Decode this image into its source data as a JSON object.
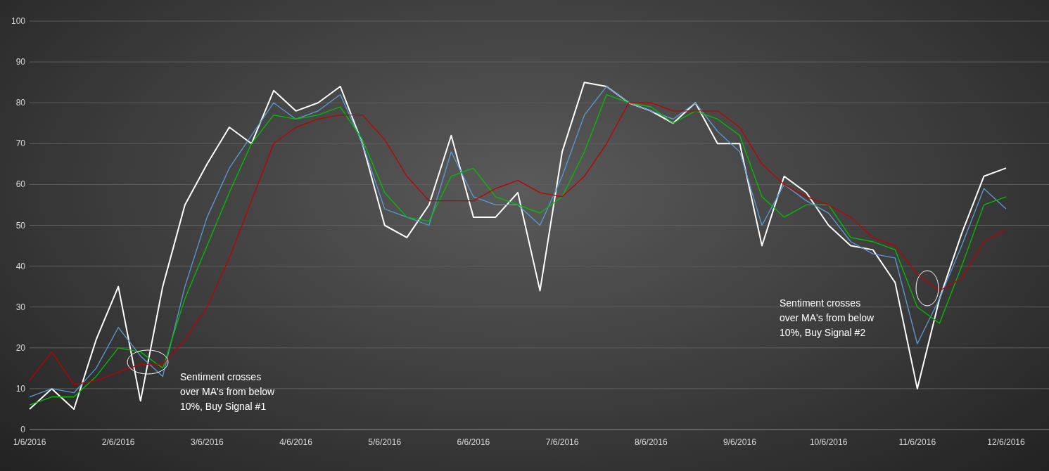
{
  "chart_data": {
    "type": "line",
    "categories": [
      "1/6/2016",
      null,
      null,
      null,
      "2/6/2016",
      null,
      null,
      null,
      "3/6/2016",
      null,
      null,
      null,
      "4/6/2016",
      null,
      null,
      null,
      "5/6/2016",
      null,
      null,
      null,
      "6/6/2016",
      null,
      null,
      null,
      "7/6/2016",
      null,
      null,
      null,
      "8/6/2016",
      null,
      null,
      null,
      "9/6/2016",
      null,
      null,
      null,
      "10/6/2016",
      null,
      null,
      null,
      "11/6/2016",
      null,
      null,
      null,
      "12/6/2016"
    ],
    "series": [
      {
        "color": "#ffffff",
        "values": [
          5,
          10,
          5,
          22,
          35,
          7,
          35,
          55,
          65,
          74,
          70,
          83,
          78,
          80,
          84,
          70,
          50,
          47,
          55,
          72,
          52,
          52,
          58,
          34,
          68,
          85,
          84,
          80,
          78,
          75,
          80,
          70,
          70,
          45,
          62,
          58,
          50,
          45,
          44,
          36,
          10,
          32,
          48,
          62,
          64
        ]
      },
      {
        "color": "#5b9bd5",
        "values": [
          8,
          10,
          9,
          15,
          25,
          18,
          13,
          35,
          52,
          64,
          72,
          80,
          76,
          78,
          82,
          70,
          54,
          52,
          50,
          68,
          57,
          55,
          55,
          50,
          62,
          77,
          84,
          80,
          78,
          76,
          80,
          73,
          68,
          50,
          60,
          56,
          53,
          46,
          43,
          42,
          21,
          32,
          45,
          59,
          54
        ]
      },
      {
        "color": "#00c000",
        "values": [
          6,
          8,
          8,
          13,
          20,
          19,
          15,
          32,
          45,
          58,
          70,
          77,
          76,
          77,
          79,
          71,
          58,
          52,
          51,
          62,
          64,
          57,
          55,
          53,
          57,
          68,
          82,
          80,
          79,
          75,
          78,
          76,
          72,
          57,
          52,
          55,
          55,
          47,
          46,
          44,
          30,
          26,
          40,
          55,
          57
        ]
      },
      {
        "color": "#c00000",
        "values": [
          12,
          19,
          11,
          12,
          14,
          16,
          16,
          22,
          30,
          42,
          56,
          70,
          74,
          76,
          77,
          77,
          71,
          62,
          56,
          56,
          56,
          59,
          61,
          58,
          57,
          62,
          70,
          80,
          80,
          78,
          78,
          78,
          74,
          65,
          60,
          57,
          55,
          52,
          47,
          45,
          38,
          34,
          37,
          46,
          49
        ]
      }
    ],
    "ylim": [
      0,
      100
    ],
    "grid": true,
    "yticks": [
      0,
      10,
      20,
      30,
      40,
      50,
      60,
      70,
      80,
      90,
      100
    ],
    "annotations": [
      "Sentiment crosses\nover MA's from below\n10%, Buy Signal #1",
      "Sentiment crosses\nover MA's from below\n10%, Buy Signal #2"
    ]
  }
}
